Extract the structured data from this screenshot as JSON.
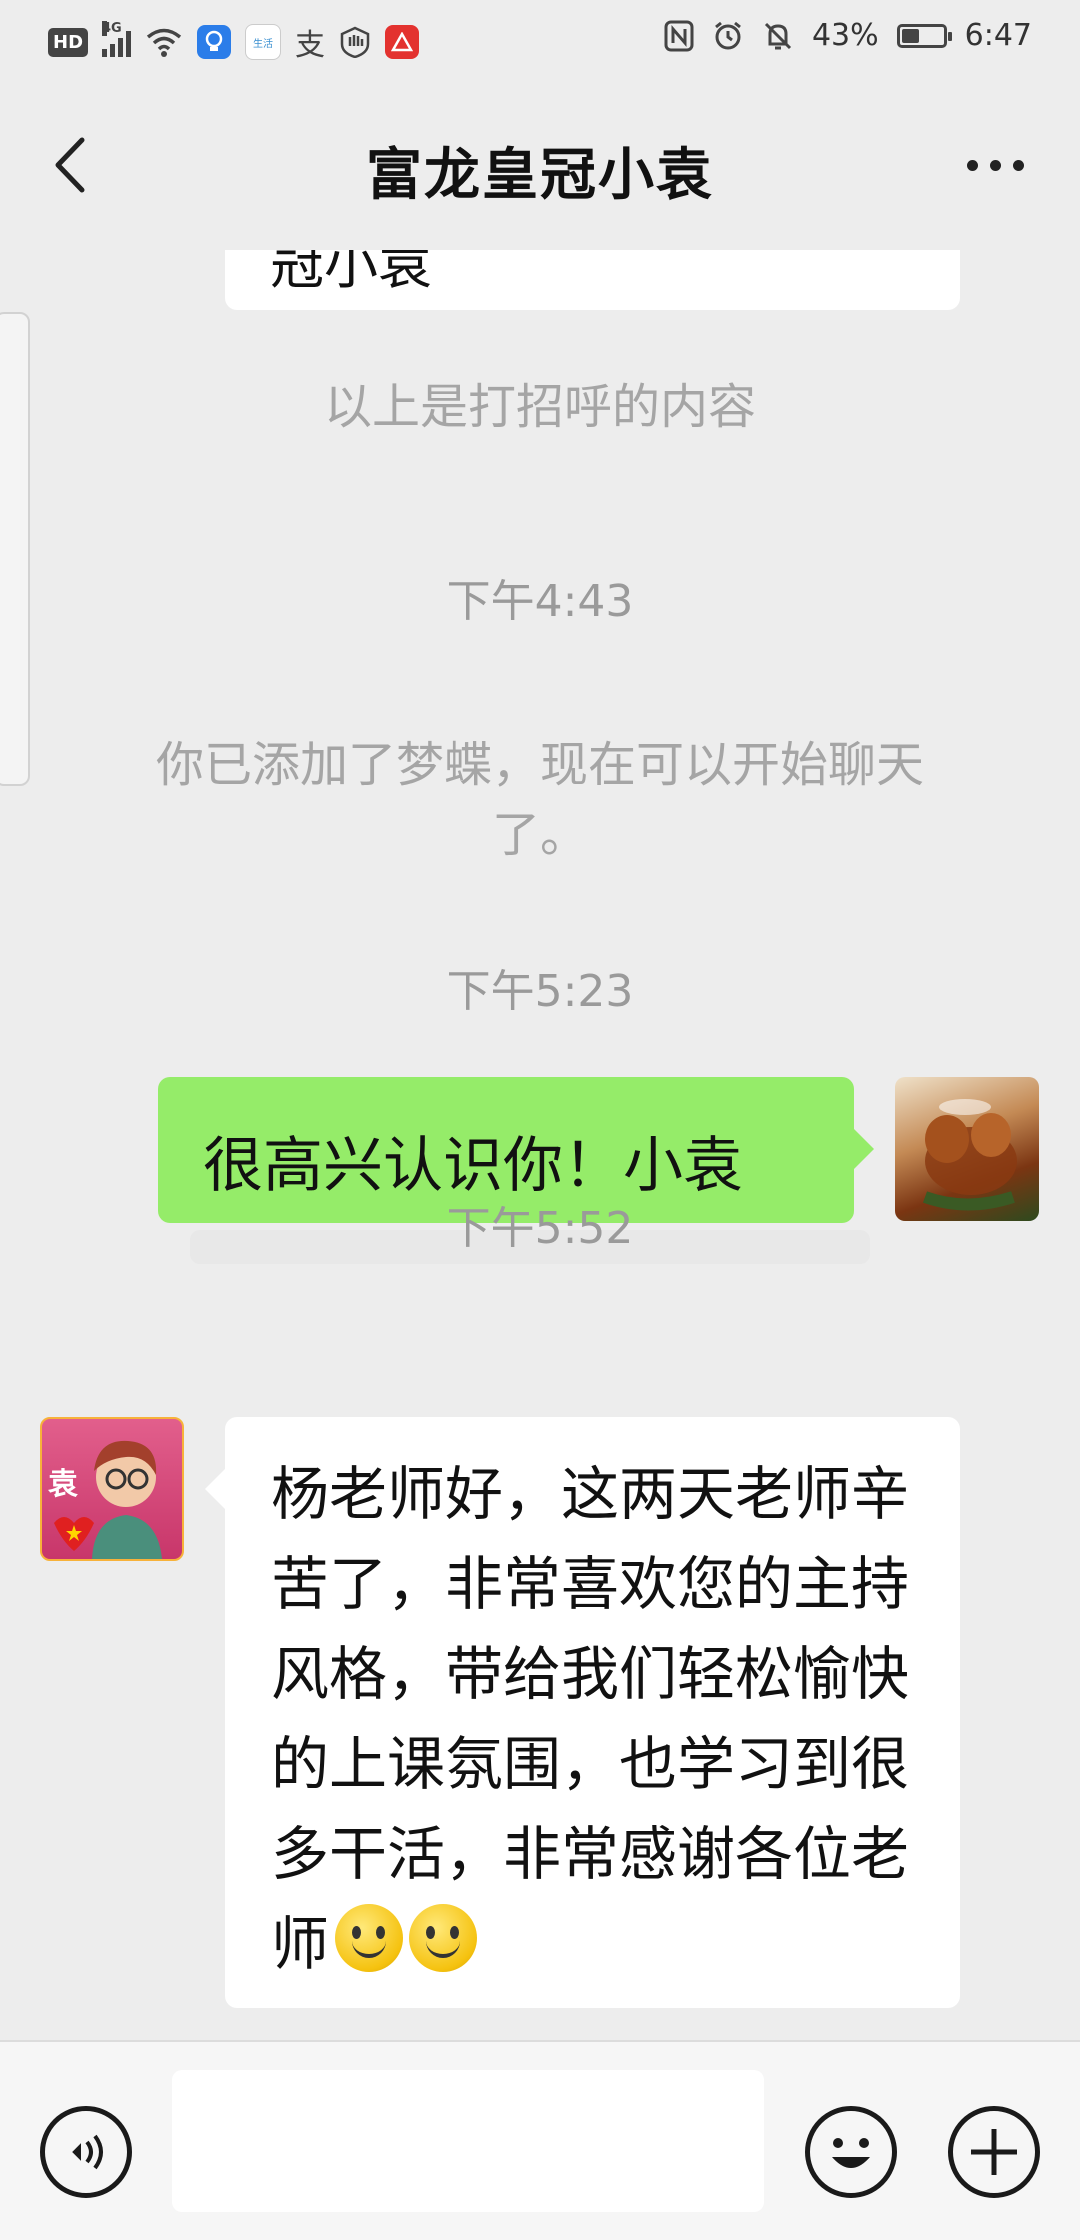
{
  "status_bar": {
    "hd": "HD",
    "network": "4G",
    "app2_label": "生活",
    "pay_label": "支",
    "battery": "43%",
    "battery_level": 0.43,
    "time": "6:47"
  },
  "header": {
    "title": "富龙皇冠小袁",
    "back_icon": "chevron-left-icon",
    "more_icon": "more-dots-icon"
  },
  "messages": {
    "cut_text": "冠小袁",
    "greeting_note": "以上是打招呼的内容",
    "time_1": "下午4:43",
    "added_note": "你已添加了梦蝶，现在可以开始聊天了。",
    "time_2": "下午5:23",
    "sent_text": "很高兴认识你！小袁",
    "time_3": "下午5:52",
    "received_text": "杨老师好，这两天老师辛苦了，非常喜欢您的主持风格，带给我们轻松愉快的上课氛围，也学习到很多干活，非常感谢各位老师",
    "received_emoji": [
      "smile-emoji",
      "smile-emoji"
    ]
  },
  "avatar_other_label": "袁",
  "bottom_bar": {
    "voice_icon": "voice-icon",
    "input_value": "",
    "emoji_icon": "emoji-icon",
    "plus_icon": "plus-icon"
  },
  "colors": {
    "background": "#ededed",
    "sent_bubble": "#95ec69",
    "received_bubble": "#ffffff",
    "system_text": "#a5a5a5"
  }
}
